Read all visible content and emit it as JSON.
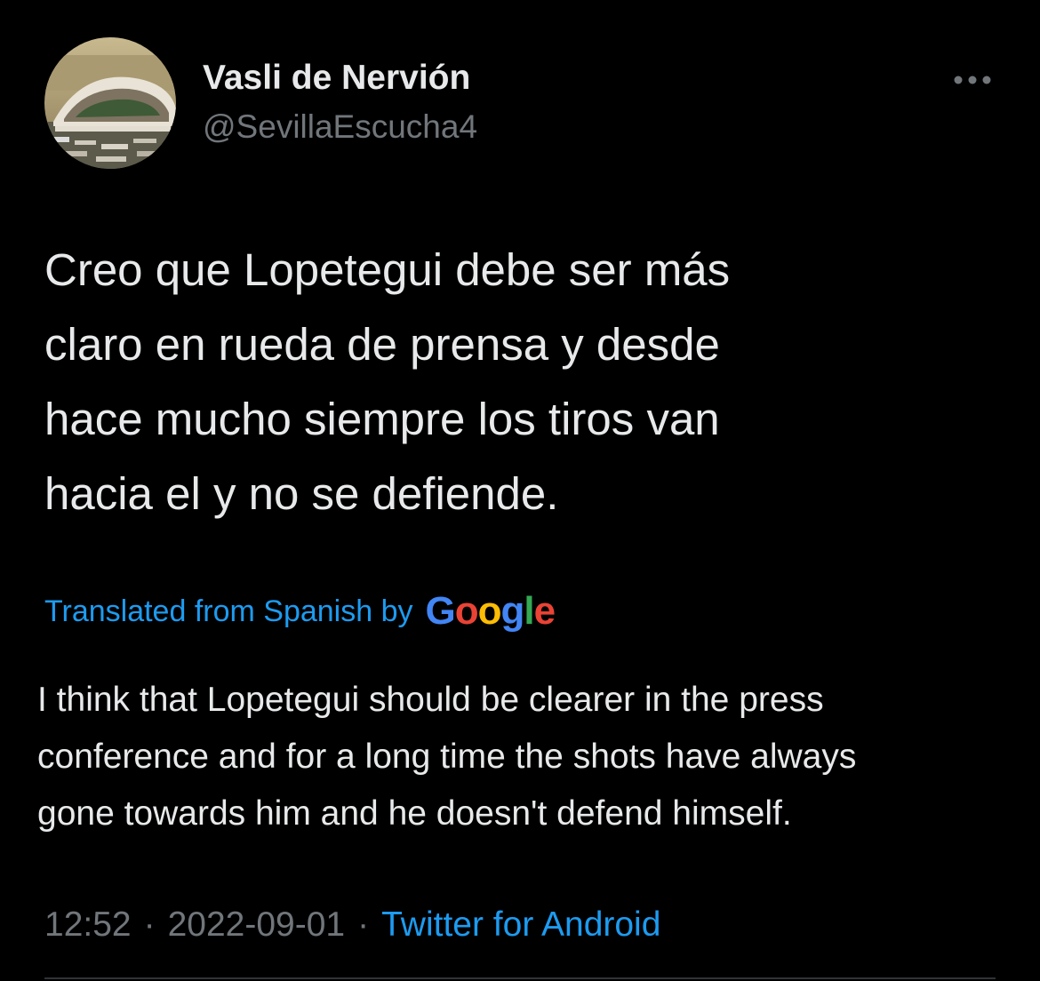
{
  "author": {
    "display_name": "Vasli de Nervión",
    "handle": "@SevillaEscucha4",
    "avatar_icon": "stadium-photo-avatar"
  },
  "more_icon": "more-horizontal-icon",
  "tweet": {
    "text_lines": [
      "Creo que Lopetegui debe ser más",
      "claro en rueda de prensa y desde",
      "hace mucho siempre los tiros van",
      "hacia el y no se defiende."
    ]
  },
  "translation": {
    "label": "Translated from Spanish by",
    "provider_letters": [
      "G",
      "o",
      "o",
      "g",
      "l",
      "e"
    ],
    "text_lines": [
      "I think that Lopetegui should be clearer in the press",
      "conference and for a long time the shots have always",
      "gone towards him and he doesn't defend himself."
    ]
  },
  "meta": {
    "time": "12:52",
    "separator": "·",
    "date": "2022-09-01",
    "source": "Twitter for Android"
  },
  "colors": {
    "background": "#000000",
    "text": "#e7e9ea",
    "muted": "#71767b",
    "link": "#1d9bf0",
    "google_blue": "#4285f4",
    "google_red": "#ea4335",
    "google_yellow": "#fbbc05",
    "google_green": "#34a853"
  }
}
